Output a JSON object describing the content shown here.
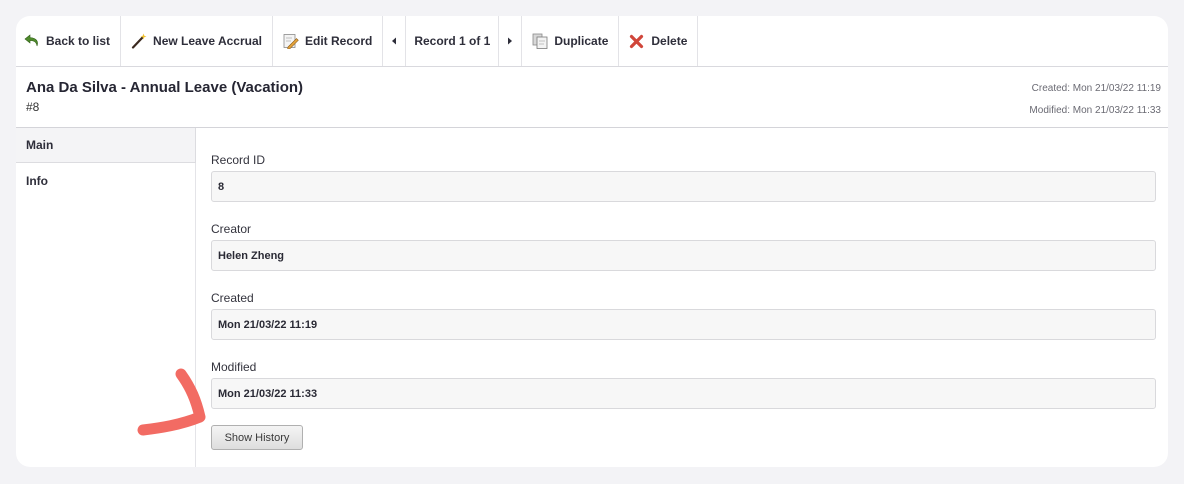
{
  "toolbar": {
    "back_label": "Back to list",
    "new_label": "New Leave Accrual",
    "edit_label": "Edit Record",
    "counter": "Record 1 of 1",
    "duplicate_label": "Duplicate",
    "delete_label": "Delete"
  },
  "header": {
    "title": "Ana Da Silva - Annual Leave (Vacation)",
    "subtitle": "#8",
    "created": "Created: Mon 21/03/22 11:19",
    "modified": "Modified: Mon 21/03/22 11:33"
  },
  "sidebar": {
    "items": [
      {
        "label": "Main",
        "active": true
      },
      {
        "label": "Info",
        "active": false
      }
    ]
  },
  "fields": [
    {
      "label": "Record ID",
      "value": "8"
    },
    {
      "label": "Creator",
      "value": "Helen Zheng"
    },
    {
      "label": "Created",
      "value": "Mon 21/03/22 11:19"
    },
    {
      "label": "Modified",
      "value": "Mon 21/03/22 11:33"
    }
  ],
  "history_button": "Show History",
  "colors": {
    "annotation": "#f26b63",
    "background": "#f3f3f6",
    "delete_icon": "#d0463a"
  },
  "icons": [
    "undo-arrow-icon",
    "magic-wand-icon",
    "edit-pencil-icon",
    "prev-triangle-icon",
    "next-triangle-icon",
    "duplicate-page-icon",
    "delete-x-icon"
  ]
}
